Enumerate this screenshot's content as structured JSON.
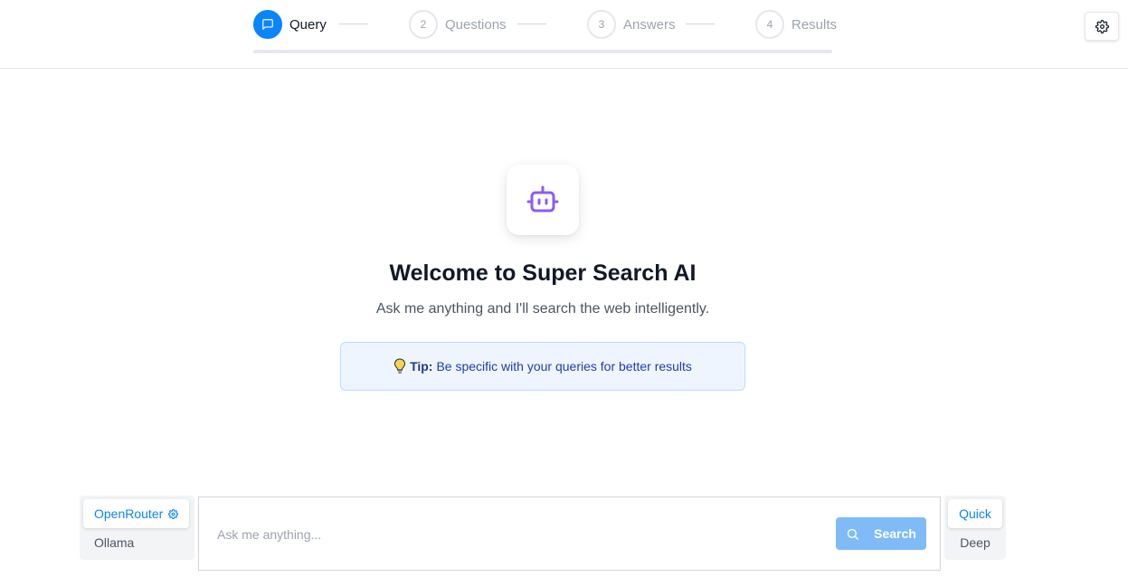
{
  "stepper": {
    "steps": [
      {
        "number": "",
        "label": "Query",
        "active": true
      },
      {
        "number": "2",
        "label": "Questions",
        "active": false
      },
      {
        "number": "3",
        "label": "Answers",
        "active": false
      },
      {
        "number": "4",
        "label": "Results",
        "active": false
      }
    ],
    "progress_fraction": 0
  },
  "icons": {
    "settings": "gear-icon",
    "step1": "chat-bubble-icon",
    "hero": "robot-icon",
    "tip": "lightbulb-icon",
    "provider_settings": "gear-icon",
    "search": "search-icon"
  },
  "hero": {
    "title": "Welcome to Super Search AI",
    "subtitle": "Ask me anything and I'll search the web intelligently."
  },
  "tip": {
    "label": "Tip:",
    "text": "Be specific with your queries for better results"
  },
  "provider": {
    "options": [
      "OpenRouter",
      "Ollama"
    ],
    "selected": "OpenRouter"
  },
  "search": {
    "placeholder": "Ask me anything...",
    "value": "",
    "button_label": "Search"
  },
  "mode": {
    "options": [
      "Quick",
      "Deep"
    ],
    "selected": "Quick"
  },
  "colors": {
    "accent": "#0a84ff",
    "bot_purple": "#8b5cf6",
    "tip_bg": "#eef5fe",
    "search_button": "#7fbbf7"
  }
}
